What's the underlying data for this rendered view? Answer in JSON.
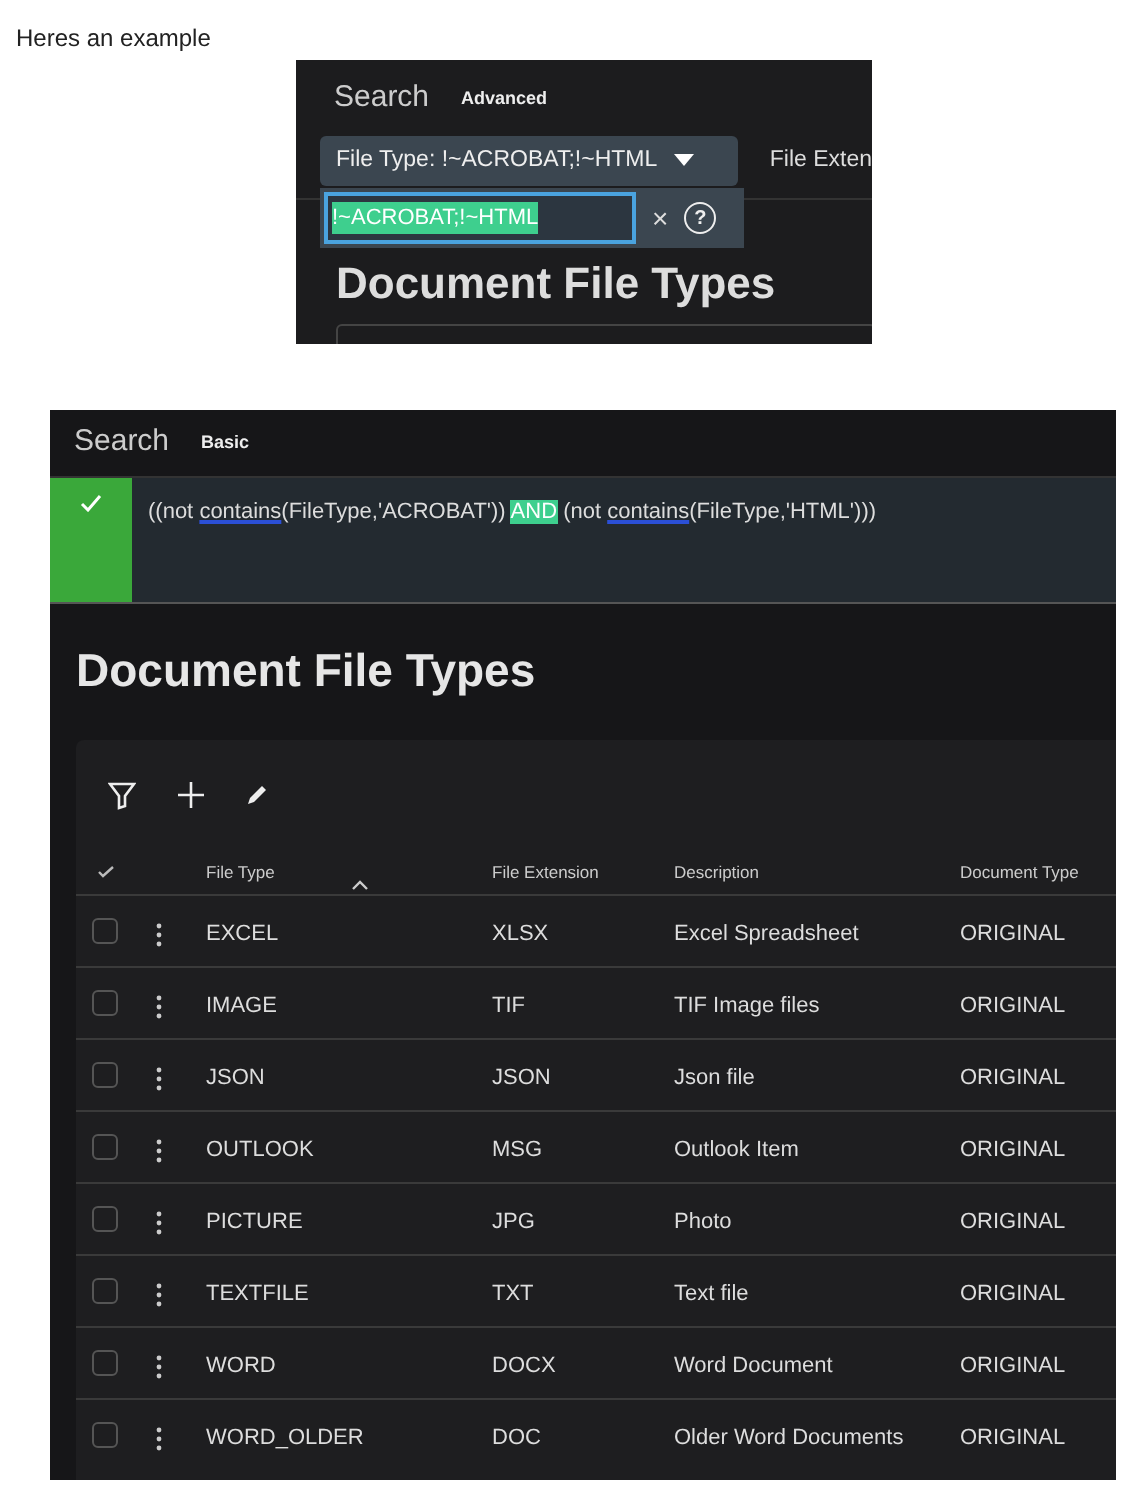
{
  "post_text": "Heres an example",
  "advanced_view": {
    "search_label": "Search",
    "mode_link": "Advanced",
    "filter_chip": "File Type: !~ACROBAT;!~HTML",
    "next_chip": "File Exten",
    "editor_value": "!~ACROBAT;!~HTML",
    "clear_glyph": "×",
    "help_glyph": "?",
    "heading": "Document File Types"
  },
  "basic_view": {
    "search_label": "Search",
    "mode_link": "Basic",
    "query_valid": true,
    "query": [
      {
        "kind": "plain",
        "text": "((not "
      },
      {
        "kind": "function",
        "text": "contains"
      },
      {
        "kind": "plain",
        "text": "(FileType,'ACROBAT')) "
      },
      {
        "kind": "keyword",
        "text": "AND"
      },
      {
        "kind": "plain",
        "text": " (not "
      },
      {
        "kind": "function",
        "text": "contains"
      },
      {
        "kind": "plain",
        "text": "(FileType,'HTML')))"
      }
    ],
    "heading": "Document File Types",
    "table": {
      "columns": [
        "File Type",
        "File Extension",
        "Description",
        "Document Type"
      ],
      "rows": [
        {
          "cells": [
            "EXCEL",
            "XLSX",
            "Excel Spreadsheet",
            "ORIGINAL"
          ],
          "selected": false
        },
        {
          "cells": [
            "IMAGE",
            "TIF",
            "TIF Image files",
            "ORIGINAL"
          ],
          "selected": false
        },
        {
          "cells": [
            "JSON",
            "JSON",
            "Json file",
            "ORIGINAL"
          ],
          "selected": false
        },
        {
          "cells": [
            "OUTLOOK",
            "MSG",
            "Outlook Item",
            "ORIGINAL"
          ],
          "selected": false
        },
        {
          "cells": [
            "PICTURE",
            "JPG",
            "Photo",
            "ORIGINAL"
          ],
          "selected": false
        },
        {
          "cells": [
            "TEXTFILE",
            "TXT",
            "Text file",
            "ORIGINAL"
          ],
          "selected": false
        },
        {
          "cells": [
            "WORD",
            "DOCX",
            "Word Document",
            "ORIGINAL"
          ],
          "selected": false
        },
        {
          "cells": [
            "WORD_OLDER",
            "DOC",
            "Older Word Documents",
            "ORIGINAL"
          ],
          "selected": false
        }
      ]
    }
  }
}
